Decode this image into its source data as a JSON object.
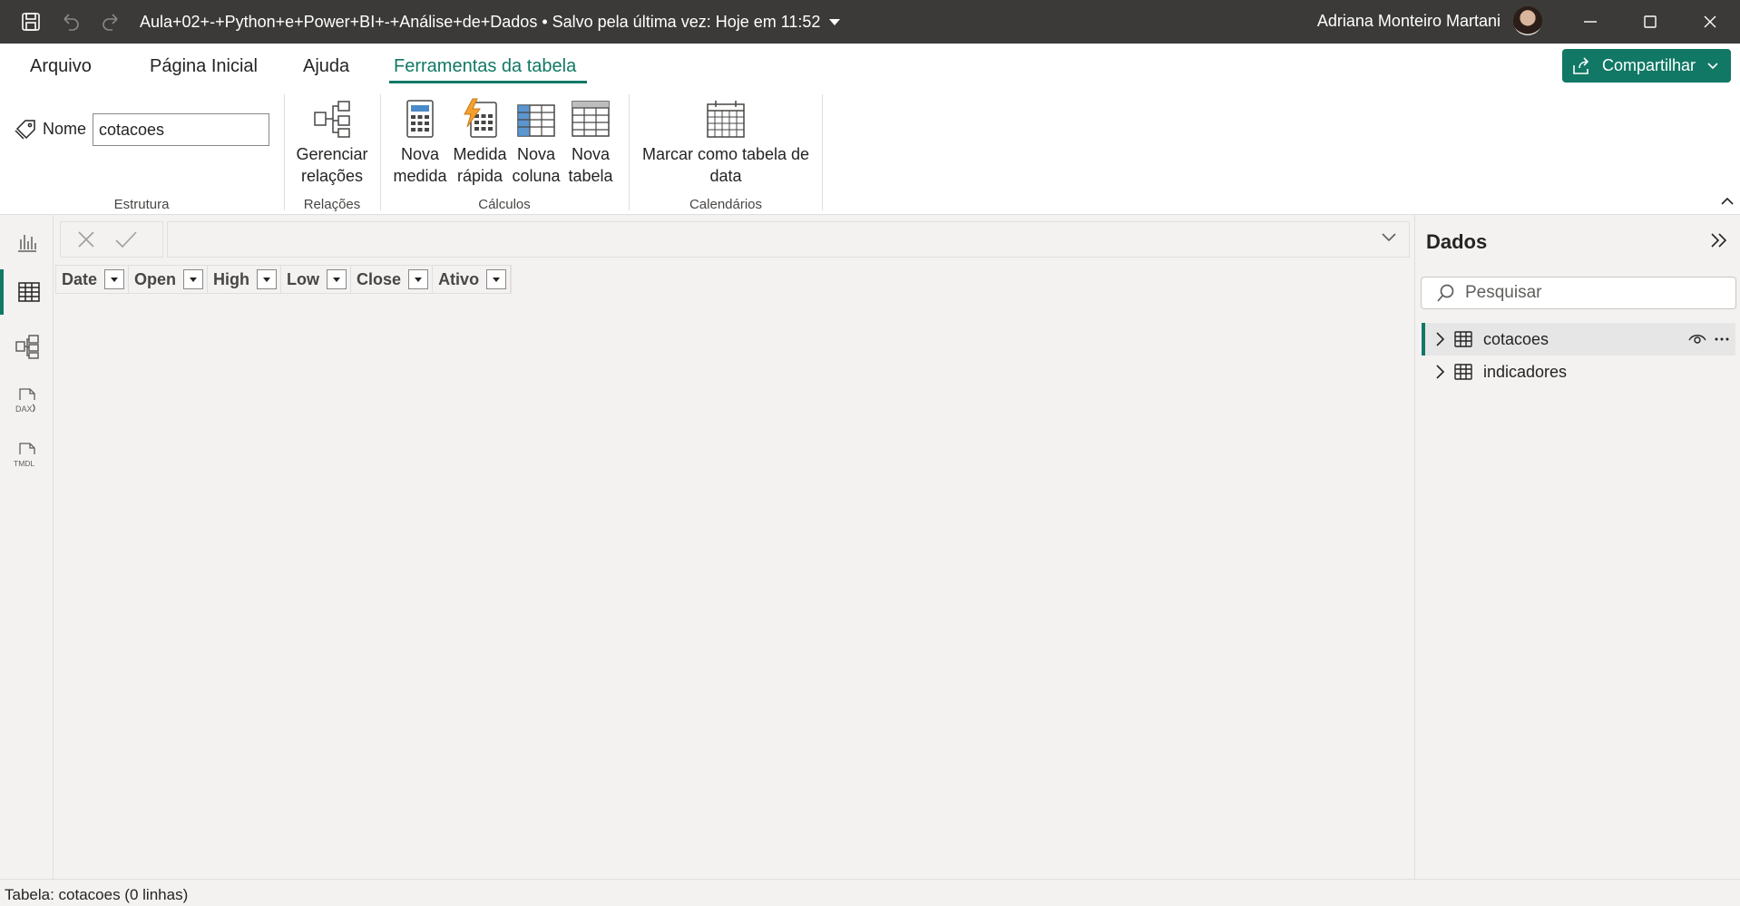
{
  "titlebar": {
    "doc_title": "Aula+02+-+Python+e+Power+BI+-+Análise+de+Dados • Salvo pela última vez: Hoje em 11:52",
    "user_name": "Adriana Monteiro Martani"
  },
  "ribbon": {
    "tabs": [
      "Arquivo",
      "Página Inicial",
      "Ajuda",
      "Ferramentas da tabela"
    ],
    "active_tab": "Ferramentas da tabela",
    "share_label": "Compartilhar",
    "name_label": "Nome",
    "name_value": "cotacoes",
    "buttons": {
      "manage_relations": [
        "Gerenciar",
        "relações"
      ],
      "new_measure": [
        "Nova",
        "medida"
      ],
      "quick_measure": [
        "Medida",
        "rápida"
      ],
      "new_column": [
        "Nova",
        "coluna"
      ],
      "new_table": [
        "Nova",
        "tabela"
      ],
      "mark_date_table": [
        "Marcar como tabela de",
        "data"
      ]
    },
    "groups": [
      "Estrutura",
      "Relações",
      "Cálculos",
      "Calendários"
    ]
  },
  "grid": {
    "columns": [
      "Date",
      "Open",
      "High",
      "Low",
      "Close",
      "Ativo"
    ]
  },
  "data_pane": {
    "title": "Dados",
    "search_placeholder": "Pesquisar",
    "tables": [
      "cotacoes",
      "indicadores"
    ],
    "selected_table": "cotacoes"
  },
  "status": {
    "text": "Tabela: cotacoes (0 linhas)"
  },
  "colors": {
    "accent": "#117865",
    "titlebar": "#3b3a39",
    "background": "#f3f2f1"
  }
}
